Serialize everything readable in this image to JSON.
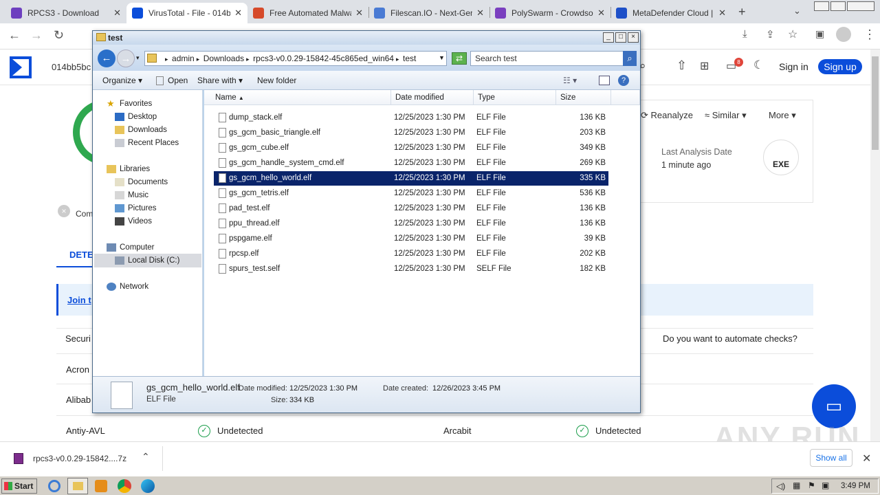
{
  "browser": {
    "tabs": [
      {
        "label": "RPCS3 - Download",
        "active": false,
        "color": "#6d3fbf"
      },
      {
        "label": "VirusTotal - File - 014bb",
        "active": true,
        "color": "#0b4dda"
      },
      {
        "label": "Free Automated Malwa",
        "active": false,
        "color": "#d64a2a"
      },
      {
        "label": "Filescan.IO - Next-Gen",
        "active": false,
        "color": "#4a7bd4"
      },
      {
        "label": "PolySwarm - Crowdsou",
        "active": false,
        "color": "#7a3fbf"
      },
      {
        "label": "MetaDefender Cloud |",
        "active": false,
        "color": "#1e50c8"
      }
    ]
  },
  "vt": {
    "hash": "014bb5bc",
    "signin": "Sign in",
    "signup": "Sign up",
    "notif_count": "8",
    "reanalyze": "Reanalyze",
    "similar": "Similar",
    "more": "More",
    "last_analysis_label": "Last Analysis Date",
    "last_analysis_value": "1 minute ago",
    "exe_badge": "EXE",
    "community": "Com",
    "detection_tab": "DETE",
    "join": "Join t",
    "security": "Securi",
    "automate": "Do you want to automate checks?",
    "vendors_left": [
      "Acron",
      "Alibab",
      "Antiy-AVL"
    ],
    "last_row": {
      "vendor_left": "Antiy-AVL",
      "status_left": "Undetected",
      "vendor_right": "Arcabit",
      "status_right": "Undetected"
    },
    "brand": "#0b4dda"
  },
  "explorer": {
    "title": "test",
    "breadcrumb": [
      "admin",
      "Downloads",
      "rpcs3-v0.0.29-15842-45c865ed_win64",
      "test"
    ],
    "search_placeholder": "Search test",
    "commands": {
      "organize": "Organize",
      "open": "Open",
      "share": "Share with",
      "new_folder": "New folder"
    },
    "nav": {
      "favorites": "Favorites",
      "desktop": "Desktop",
      "downloads": "Downloads",
      "recent": "Recent Places",
      "libraries": "Libraries",
      "documents": "Documents",
      "music": "Music",
      "pictures": "Pictures",
      "videos": "Videos",
      "computer": "Computer",
      "localdisk": "Local Disk (C:)",
      "network": "Network"
    },
    "columns": {
      "name": "Name",
      "date": "Date modified",
      "type": "Type",
      "size": "Size"
    },
    "files": [
      {
        "name": "dump_stack.elf",
        "date": "12/25/2023 1:30 PM",
        "type": "ELF File",
        "size": "136 KB"
      },
      {
        "name": "gs_gcm_basic_triangle.elf",
        "date": "12/25/2023 1:30 PM",
        "type": "ELF File",
        "size": "203 KB"
      },
      {
        "name": "gs_gcm_cube.elf",
        "date": "12/25/2023 1:30 PM",
        "type": "ELF File",
        "size": "349 KB"
      },
      {
        "name": "gs_gcm_handle_system_cmd.elf",
        "date": "12/25/2023 1:30 PM",
        "type": "ELF File",
        "size": "269 KB"
      },
      {
        "name": "gs_gcm_hello_world.elf",
        "date": "12/25/2023 1:30 PM",
        "type": "ELF File",
        "size": "335 KB"
      },
      {
        "name": "gs_gcm_tetris.elf",
        "date": "12/25/2023 1:30 PM",
        "type": "ELF File",
        "size": "536 KB"
      },
      {
        "name": "pad_test.elf",
        "date": "12/25/2023 1:30 PM",
        "type": "ELF File",
        "size": "136 KB"
      },
      {
        "name": "ppu_thread.elf",
        "date": "12/25/2023 1:30 PM",
        "type": "ELF File",
        "size": "136 KB"
      },
      {
        "name": "pspgame.elf",
        "date": "12/25/2023 1:30 PM",
        "type": "ELF File",
        "size": "39 KB"
      },
      {
        "name": "rpcsp.elf",
        "date": "12/25/2023 1:30 PM",
        "type": "ELF File",
        "size": "202 KB"
      },
      {
        "name": "spurs_test.self",
        "date": "12/25/2023 1:30 PM",
        "type": "SELF File",
        "size": "182 KB"
      }
    ],
    "details": {
      "filename": "gs_gcm_hello_world.elf",
      "filetype": "ELF File",
      "date_modified_label": "Date modified:",
      "date_modified": "12/25/2023 1:30 PM",
      "size_label": "Size:",
      "size": "334 KB",
      "date_created_label": "Date created:",
      "date_created": "12/26/2023 3:45 PM"
    }
  },
  "download": {
    "filename": "rpcs3-v0.0.29-15842....7z",
    "show_all": "Show all"
  },
  "taskbar": {
    "start": "Start",
    "clock": "3:49 PM"
  },
  "watermark": "ANY RUN"
}
